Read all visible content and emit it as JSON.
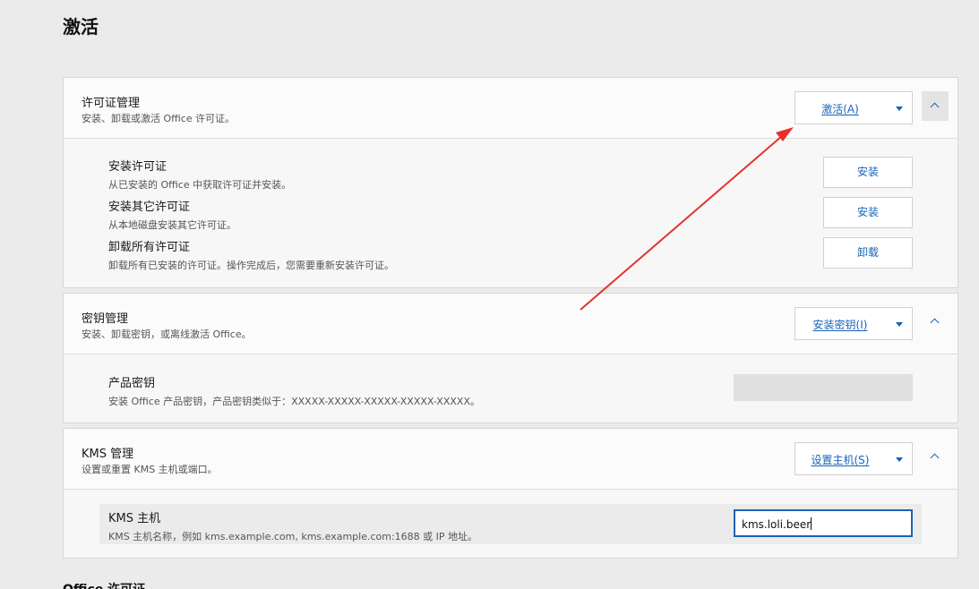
{
  "page": {
    "title": "激活",
    "next_section": "Office 许可证"
  },
  "license": {
    "title": "许可证管理",
    "desc": "安装、卸载或激活 Office 许可证。",
    "button": "激活(A)",
    "rows": [
      {
        "title": "安装许可证",
        "desc": "从已安装的 Office 中获取许可证并安装。",
        "button": "安装"
      },
      {
        "title": "安装其它许可证",
        "desc": "从本地磁盘安装其它许可证。",
        "button": "安装"
      },
      {
        "title": "卸载所有许可证",
        "desc": "卸载所有已安装的许可证。操作完成后，您需要重新安装许可证。",
        "button": "卸载"
      }
    ]
  },
  "keys": {
    "title": "密钥管理",
    "desc": "安装、卸载密钥，或离线激活 Office。",
    "button": "安装密钥(I)",
    "row": {
      "title": "产品密钥",
      "desc": "安装 Office 产品密钥，产品密钥类似于：XXXXX-XXXXX-XXXXX-XXXXX-XXXXX。",
      "value": ""
    }
  },
  "kms": {
    "title": "KMS 管理",
    "desc": "设置或重置 KMS 主机或端口。",
    "button": "设置主机(S)",
    "row": {
      "title": "KMS 主机",
      "desc": "KMS 主机名称，例如 kms.example.com, kms.example.com:1688 或 IP 地址。",
      "value": "kms.loli.beer"
    }
  },
  "icons": {
    "caret": "caret-down-icon",
    "collapse": "chevron-up-icon"
  },
  "colors": {
    "accent": "#1764b8",
    "annotation_arrow": "#e5322d"
  }
}
